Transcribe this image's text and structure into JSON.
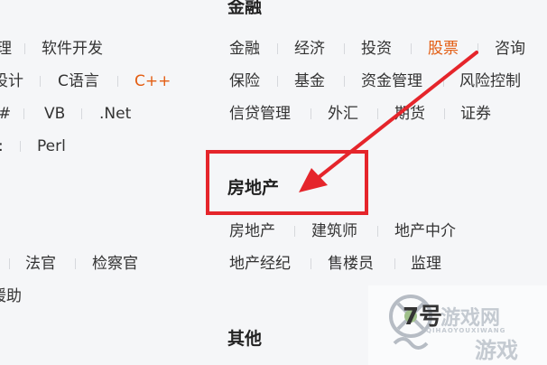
{
  "left_column": {
    "row1": [
      "理",
      "软件开发"
    ],
    "row2": [
      "设计",
      "C语言",
      "C++"
    ],
    "row3": [
      "#",
      "VB",
      ".Net"
    ],
    "row4": [
      ":",
      "Perl"
    ],
    "row5": [
      "法官",
      "检察官"
    ],
    "row6": [
      "援助"
    ]
  },
  "finance": {
    "title": "金融",
    "row1": [
      "金融",
      "经济",
      "投资",
      "股票",
      "咨询"
    ],
    "row2": [
      "保险",
      "基金",
      "资金管理",
      "风险控制"
    ],
    "row3": [
      "信贷管理",
      "外汇",
      "期货",
      "证券"
    ]
  },
  "real_estate": {
    "title": "房地产",
    "row1": [
      "房地产",
      "建筑师",
      "地产中介"
    ],
    "row2": [
      "地产经纪",
      "售楼员",
      "监理"
    ]
  },
  "other": {
    "title": "其他"
  },
  "watermark": {
    "number": "7号",
    "brand": "游戏网",
    "sub": "QIHAOYOUXIWANG",
    "game": "游戏"
  },
  "colors": {
    "highlight": "#e35d12",
    "annotation": "#e5252b"
  }
}
